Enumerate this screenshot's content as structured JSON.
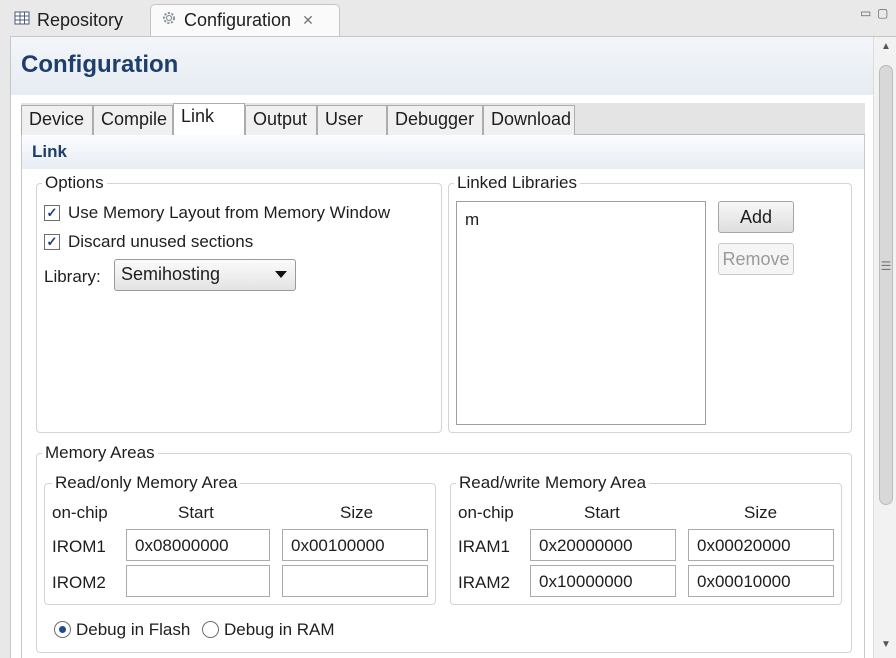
{
  "view_tabs": [
    {
      "label": "Repository",
      "icon": "table-icon"
    },
    {
      "label": "Configuration",
      "icon": "gear-icon",
      "close": "✕"
    }
  ],
  "window_controls": {
    "minimize": "▭",
    "maximize": "▢"
  },
  "header": {
    "title": "Configuration"
  },
  "tabs": [
    "Device",
    "Compile",
    "Link",
    "Output",
    "User",
    "Debugger",
    "Download"
  ],
  "selected_tab": "Link",
  "link": {
    "section_title": "Link",
    "options": {
      "legend": "Options",
      "use_memory_layout": {
        "label": "Use Memory Layout from Memory Window",
        "checked": true
      },
      "discard_unused": {
        "label": "Discard unused sections",
        "checked": true
      },
      "library_label": "Library:",
      "library_value": "Semihosting"
    },
    "linked_libraries": {
      "legend": "Linked Libraries",
      "items": [
        "m"
      ],
      "add_label": "Add",
      "remove_label": "Remove"
    },
    "memory_areas": {
      "legend": "Memory Areas",
      "readonly": {
        "legend": "Read/only Memory Area",
        "col_onchip": "on-chip",
        "col_start": "Start",
        "col_size": "Size",
        "rows": [
          {
            "name": "IROM1",
            "start": "0x08000000",
            "size": "0x00100000"
          },
          {
            "name": "IROM2",
            "start": "",
            "size": ""
          }
        ]
      },
      "readwrite": {
        "legend": "Read/write Memory Area",
        "col_onchip": "on-chip",
        "col_start": "Start",
        "col_size": "Size",
        "rows": [
          {
            "name": "IRAM1",
            "start": "0x20000000",
            "size": "0x00020000"
          },
          {
            "name": "IRAM2",
            "start": "0x10000000",
            "size": "0x00010000"
          }
        ]
      },
      "debug_flash": {
        "label": "Debug in Flash",
        "selected": true
      },
      "debug_ram": {
        "label": "Debug in RAM",
        "selected": false
      }
    }
  }
}
